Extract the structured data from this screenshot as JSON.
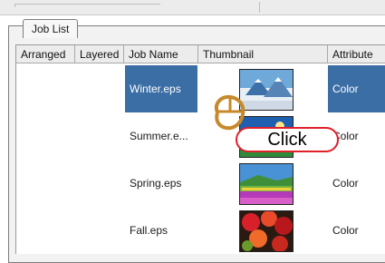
{
  "tabs": [
    {
      "label": "Job List"
    }
  ],
  "columns": [
    "Arranged",
    "Layered",
    "Job Name",
    "Thumbnail",
    "Attribute"
  ],
  "rows": [
    {
      "job_name": "Winter.eps",
      "attribute": "Color",
      "selected": true,
      "thumbnail": "winter-landscape"
    },
    {
      "job_name": "Summer.e...",
      "attribute": "Color",
      "selected": false,
      "thumbnail": "summer-landscape"
    },
    {
      "job_name": "Spring.eps",
      "attribute": "Color",
      "selected": false,
      "thumbnail": "spring-flowers"
    },
    {
      "job_name": "Fall.eps",
      "attribute": "Color",
      "selected": false,
      "thumbnail": "fall-foliage"
    }
  ],
  "callout": {
    "label": "Click",
    "border_color": "#e0202a"
  },
  "colors": {
    "selection": "#3a6ea5",
    "cursor": "#c8892c"
  },
  "icons": {
    "cursor": "mouse-click-icon"
  }
}
